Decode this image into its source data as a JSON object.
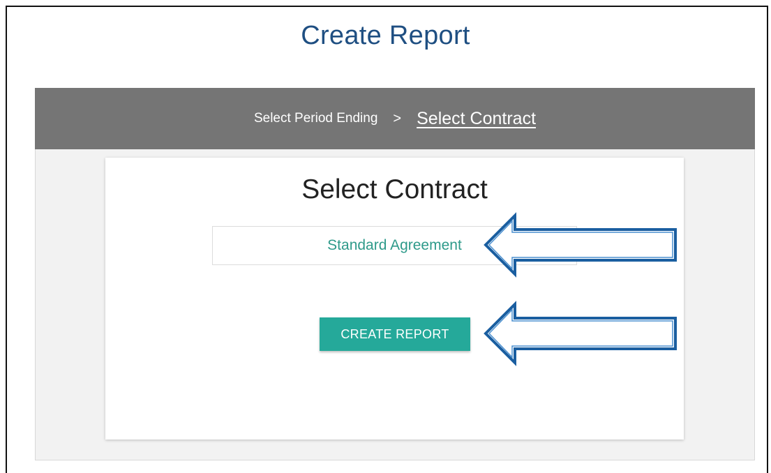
{
  "page": {
    "title": "Create Report"
  },
  "steps": {
    "step1_label": "Select Period Ending",
    "separator": ">",
    "step2_label": "Select Contract"
  },
  "card": {
    "title": "Select Contract",
    "contract_option": "Standard Agreement",
    "create_button_label": "CREATE REPORT"
  },
  "colors": {
    "title": "#1f4f82",
    "steps_bar": "#757575",
    "accent": "#25a99a",
    "option_text": "#2e9a8a",
    "annotation_arrow": "#1a5ea0"
  },
  "icons": {
    "annotation": "arrow-left-icon"
  }
}
